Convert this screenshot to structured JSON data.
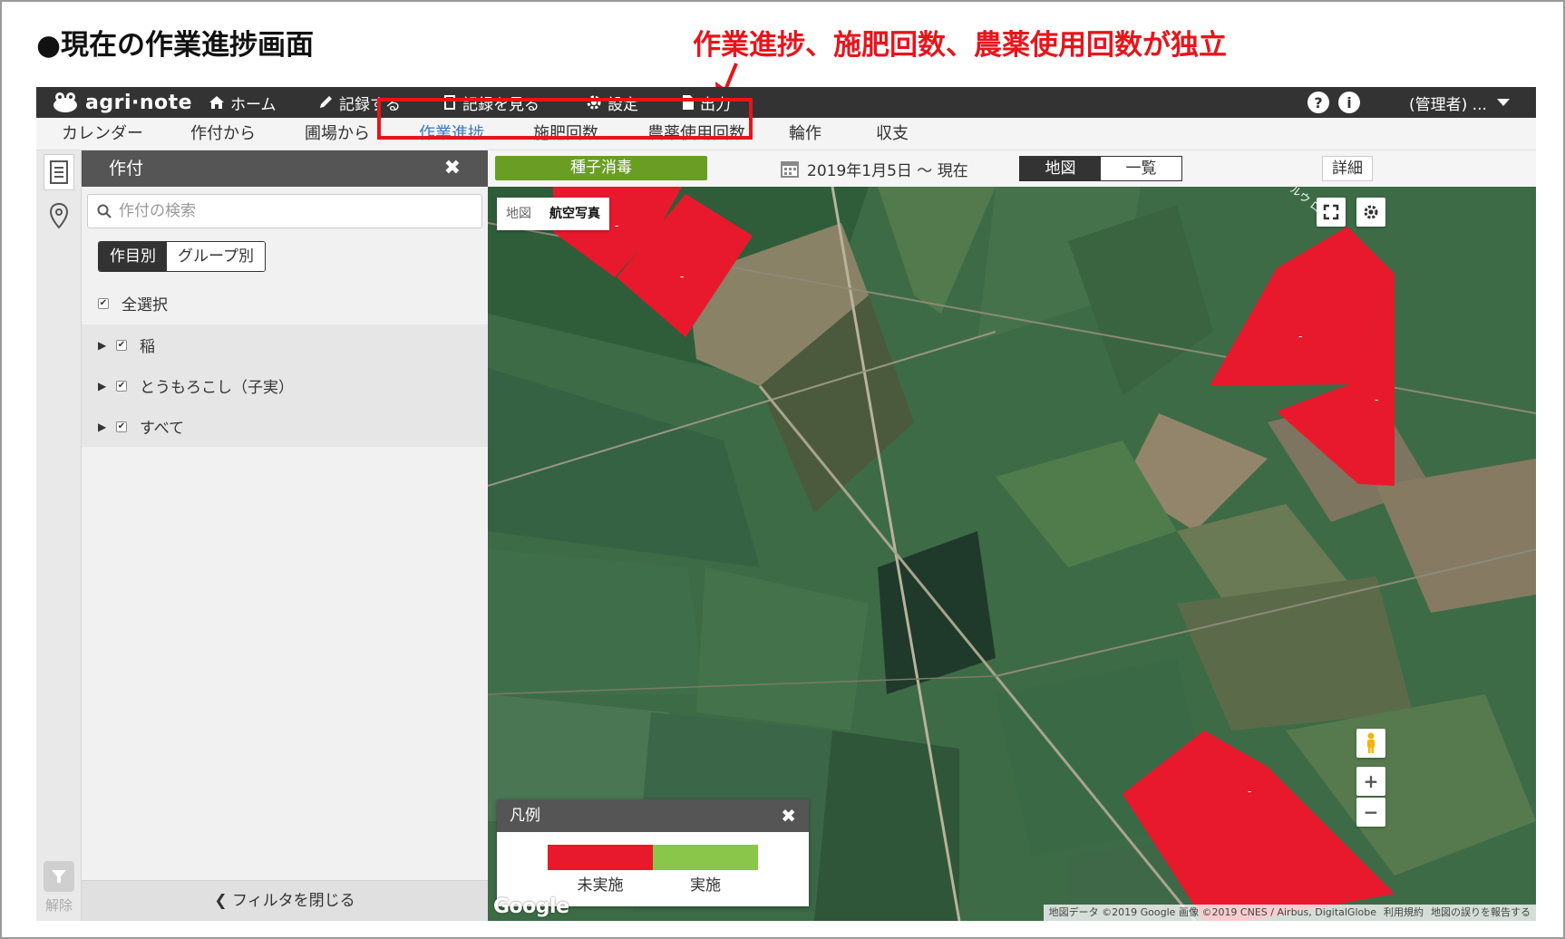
{
  "slide": {
    "title": "●現在の作業進捗画面",
    "callout": "作業進捗、施肥回数、農薬使用回数が独立"
  },
  "topbar": {
    "logo": "agri·note",
    "nav": [
      {
        "label": "ホーム",
        "icon": "home-icon"
      },
      {
        "label": "記録する",
        "icon": "pencil-icon"
      },
      {
        "label": "記録を見る",
        "icon": "book-icon"
      },
      {
        "label": "設定",
        "icon": "gear-icon"
      },
      {
        "label": "出力",
        "icon": "document-icon"
      }
    ],
    "help": "?",
    "info": "i",
    "user": "(管理者) ..."
  },
  "subnav": {
    "items": [
      "カレンダー",
      "作付から",
      "圃場から",
      "作業進捗",
      "施肥回数",
      "農薬使用回数",
      "輪作",
      "収支"
    ],
    "active_index": 3
  },
  "sidebar_rail": {
    "release_label": "解除"
  },
  "panel": {
    "title": "作付",
    "close": "✖",
    "search_placeholder": "作付の検索",
    "segment": [
      "作目別",
      "グループ別"
    ],
    "select_all": "全選択",
    "groups": [
      "稲",
      "とうもろこし（子実）",
      "すべて"
    ],
    "footer": "フィルタを閉じる"
  },
  "toolbar": {
    "task_label": "種子消毒",
    "date_range": "2019年1月5日 ～ 現在",
    "view_map": "地図",
    "view_list": "一覧",
    "detail": "詳細"
  },
  "map": {
    "type_map": "地図",
    "type_satellite": "航空写真",
    "road_label": "ルウ ロード",
    "field_marker": "-",
    "legend": {
      "title": "凡例",
      "close": "✖",
      "items": [
        {
          "label": "未実施",
          "color": "#e8192c"
        },
        {
          "label": "実施",
          "color": "#8ac64a"
        }
      ]
    },
    "google": "Google",
    "attribution": {
      "data": "地図データ ©2019 Google 画像 ©2019 CNES / Airbus, DigitalGlobe",
      "terms": "利用規約",
      "report": "地図の誤りを報告する"
    },
    "zoom_in": "+",
    "zoom_out": "−"
  },
  "colors": {
    "accent_red": "#e8141b",
    "field_red": "#e8192c",
    "task_green": "#6a9d24",
    "active_blue": "#3a78c3",
    "topbar_bg": "#333333"
  }
}
